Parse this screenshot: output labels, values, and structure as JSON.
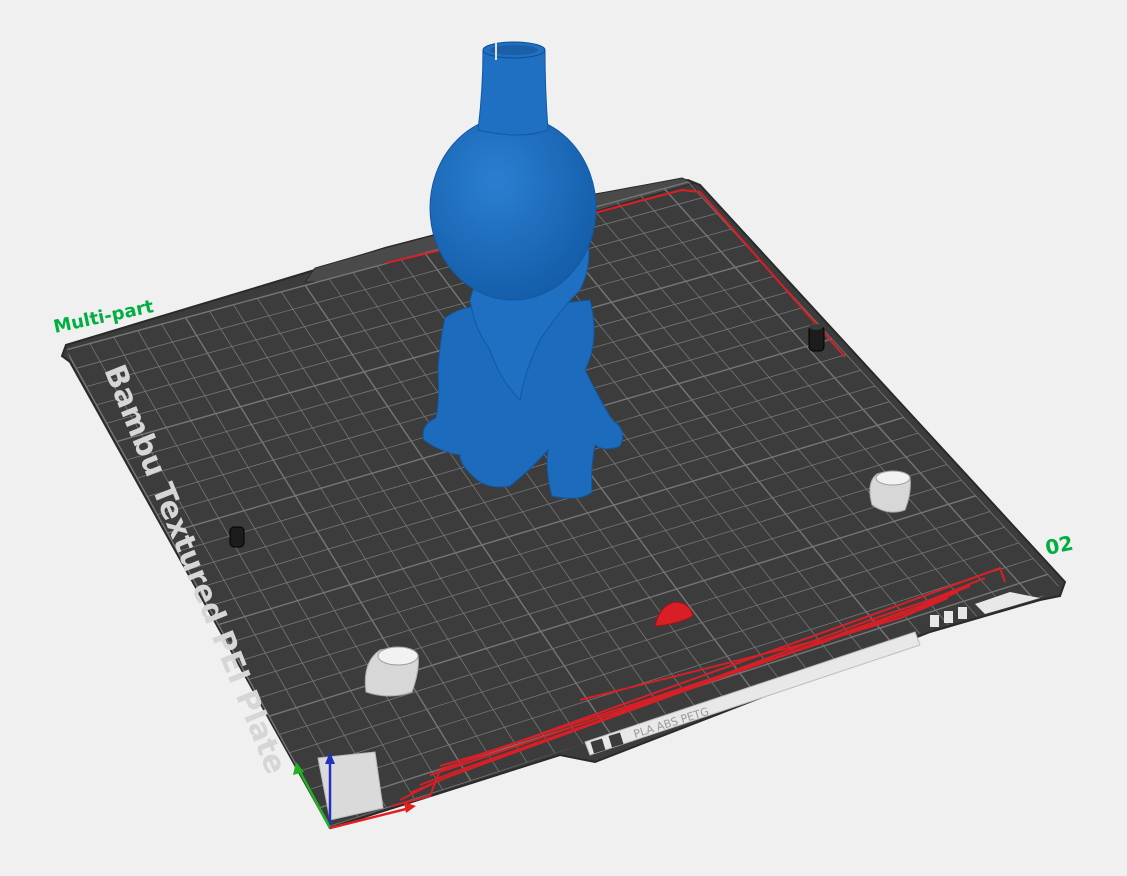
{
  "plate": {
    "name": "Multi-part",
    "number": "02",
    "brand_text": "Bambu Textured PEI Plate",
    "material_text": "PLA ABS PETG"
  },
  "colors": {
    "background": "#f0f0f0",
    "bed": "#3c3c3c",
    "grid": "#767676",
    "accent_green": "#00ae42",
    "model_blue": "#1f6fbf",
    "bed_marking_red": "#d81f26",
    "axis_x": "#e02020",
    "axis_y": "#20b020",
    "axis_z": "#2030c0"
  },
  "objects": [
    {
      "name": "vase-model",
      "color": "blue"
    },
    {
      "name": "small-black-part",
      "color": "black"
    },
    {
      "name": "small-black-part",
      "color": "black"
    },
    {
      "name": "white-cup-part",
      "color": "white"
    },
    {
      "name": "white-cup-part",
      "color": "white"
    },
    {
      "name": "red-dome-part",
      "color": "red"
    }
  ],
  "icons": [
    "axis-gizmo-icon"
  ]
}
